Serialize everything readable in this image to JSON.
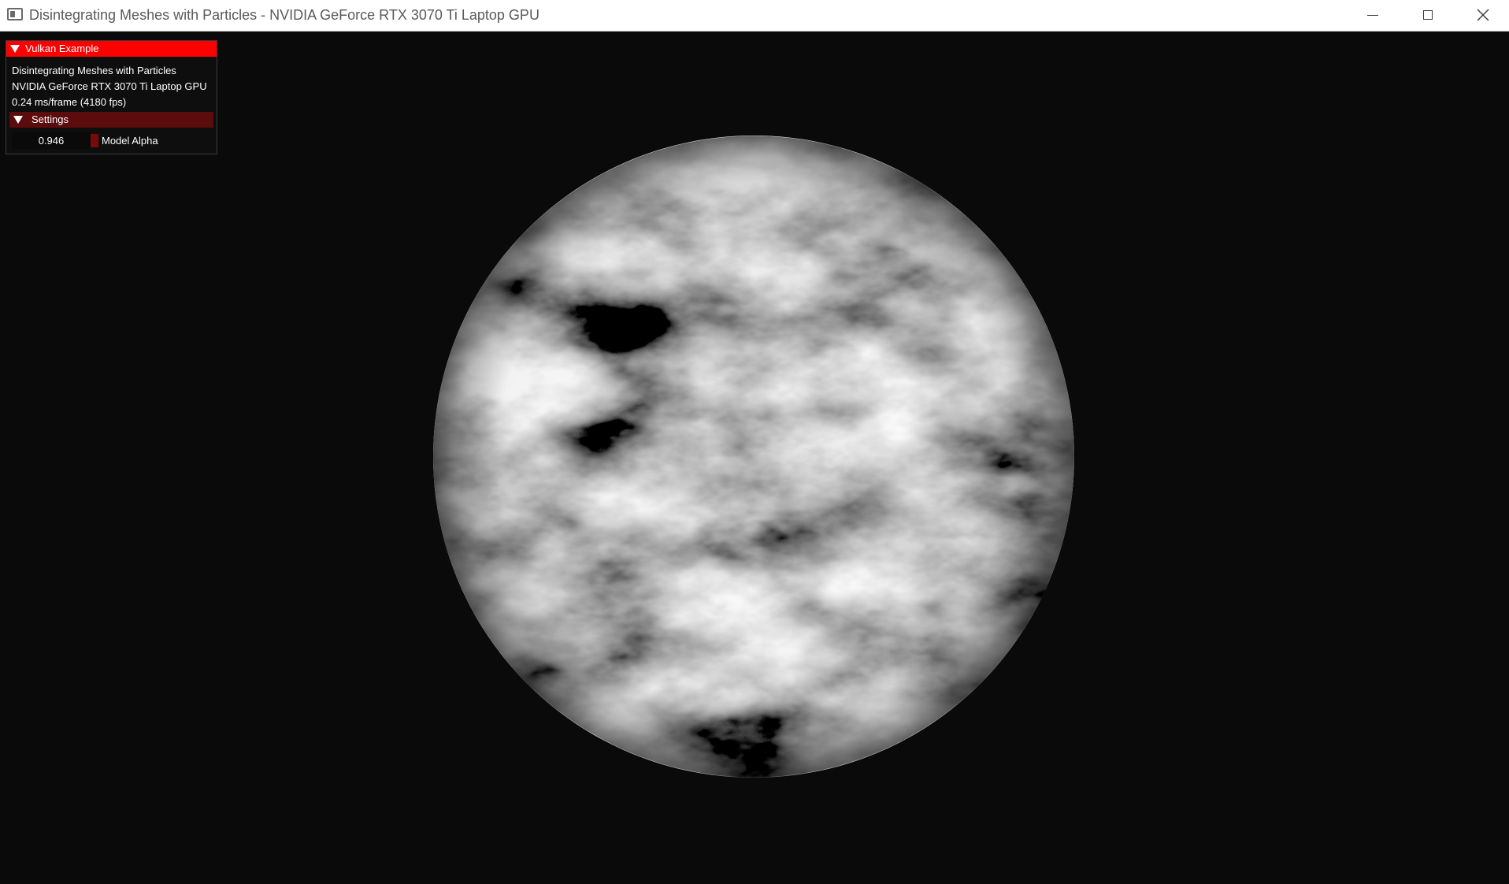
{
  "window": {
    "title": "Disintegrating Meshes with Particles - NVIDIA GeForce RTX 3070 Ti Laptop GPU",
    "controls": {
      "minimize_icon": "minimize-icon",
      "maximize_icon": "maximize-icon",
      "close_icon": "close-icon"
    }
  },
  "overlay": {
    "header_label": "Vulkan Example",
    "info": {
      "app_name": "Disintegrating Meshes with Particles",
      "gpu_name": "NVIDIA GeForce RTX 3070 Ti Laptop GPU",
      "frame_time": "0.24 ms/frame (4180 fps)"
    },
    "settings": {
      "header_label": "Settings",
      "model_alpha": {
        "value": "0.946",
        "label": "Model Alpha"
      }
    },
    "colors": {
      "header_bg": "#ff0000",
      "settings_bg": "#5c0c0c",
      "slider_grab": "#7a0a0a"
    }
  },
  "scene": {
    "background": "#0a0a0a",
    "object": "sphere"
  }
}
